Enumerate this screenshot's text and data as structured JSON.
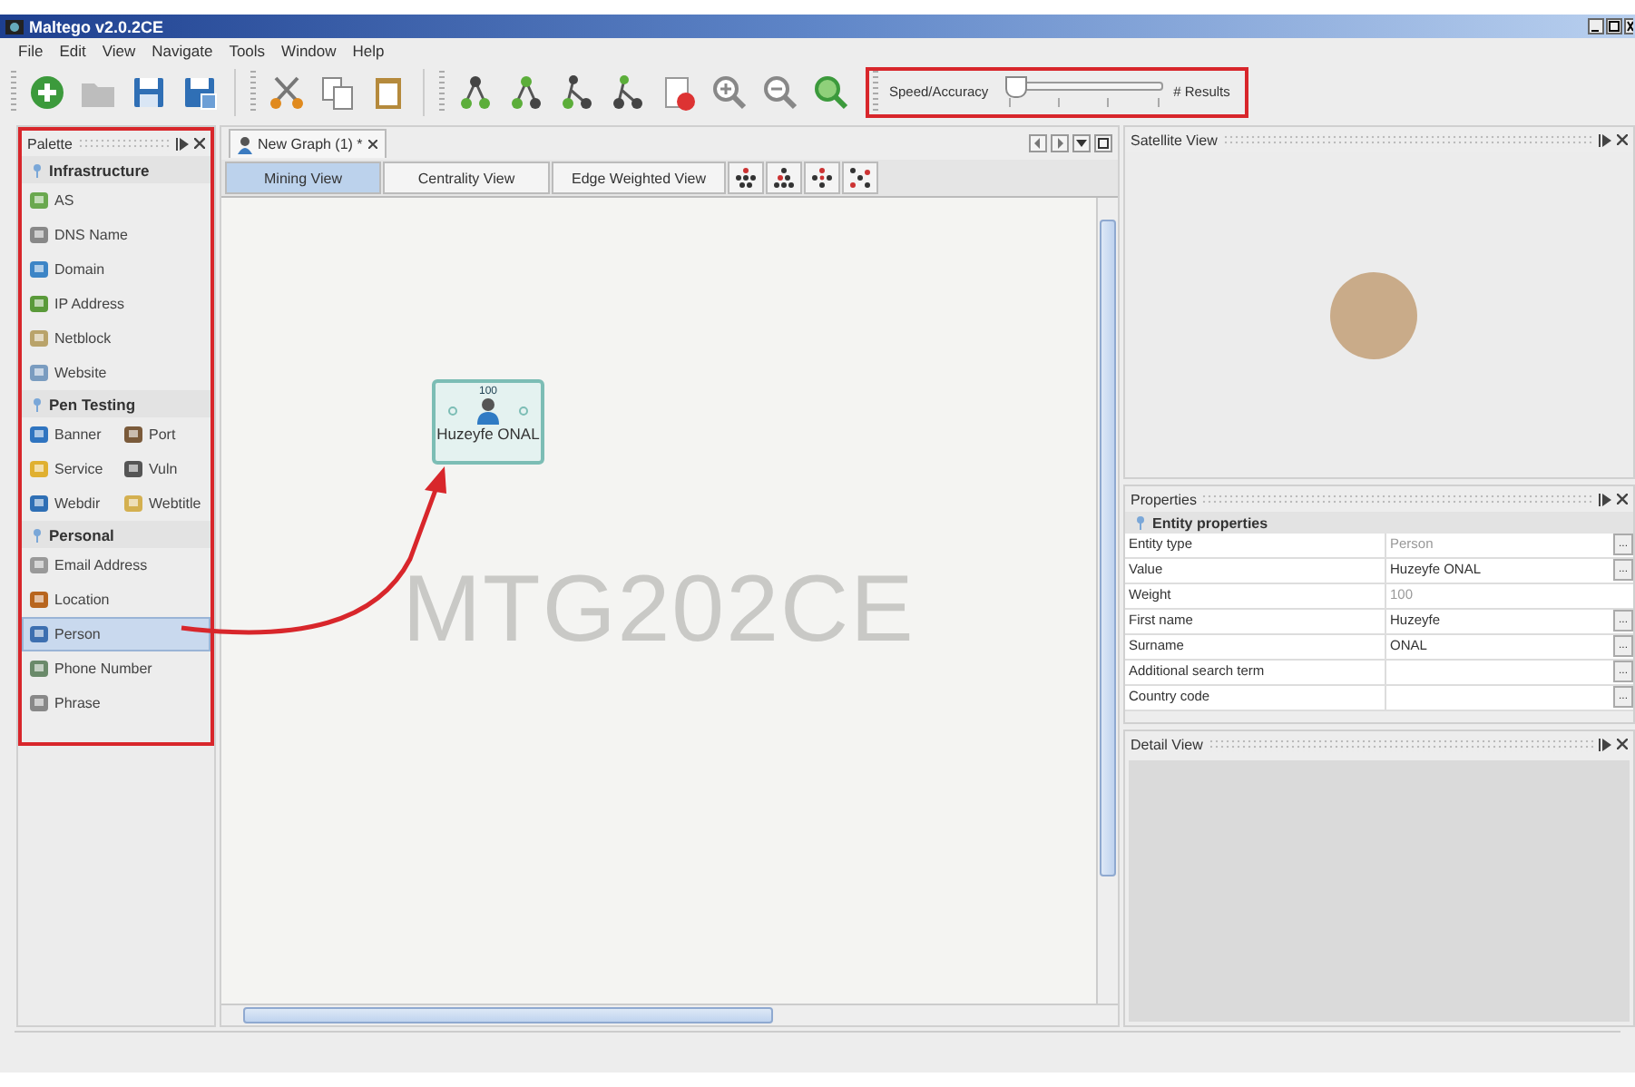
{
  "window": {
    "title": "Maltego v2.0.2CE"
  },
  "menu": [
    {
      "label": "File"
    },
    {
      "label": "Edit"
    },
    {
      "label": "View"
    },
    {
      "label": "Navigate"
    },
    {
      "label": "Tools"
    },
    {
      "label": "Window"
    },
    {
      "label": "Help"
    }
  ],
  "toolbar": {
    "slider": {
      "label": "Speed/Accuracy",
      "level": 0.04,
      "end_label": "# Results",
      "highlighted": true
    }
  },
  "palette": {
    "title": "Palette",
    "highlighted": true,
    "categories": [
      {
        "label": "Infrastructure",
        "kind": "list",
        "items": [
          {
            "label": "AS",
            "selected": false
          },
          {
            "label": "DNS Name",
            "selected": false
          },
          {
            "label": "Domain",
            "selected": false
          },
          {
            "label": "IP Address",
            "selected": false
          },
          {
            "label": "Netblock",
            "selected": false
          },
          {
            "label": "Website",
            "selected": false
          }
        ]
      },
      {
        "label": "Pen Testing",
        "kind": "grid",
        "items": [
          {
            "label": "Banner",
            "selected": false
          },
          {
            "label": "Port",
            "selected": false
          },
          {
            "label": "Service",
            "selected": false
          },
          {
            "label": "Vuln",
            "selected": false
          },
          {
            "label": "Webdir",
            "selected": false
          },
          {
            "label": "Webtitle",
            "selected": false
          }
        ]
      },
      {
        "label": "Personal",
        "kind": "list",
        "items": [
          {
            "label": "Email Address",
            "selected": false
          },
          {
            "label": "Location",
            "selected": false
          },
          {
            "label": "Person",
            "selected": true
          },
          {
            "label": "Phone Number",
            "selected": false
          },
          {
            "label": "Phrase",
            "selected": false
          }
        ]
      }
    ]
  },
  "graph": {
    "tab": {
      "label": "New Graph (1) *"
    },
    "view_tabs": [
      {
        "label": "Mining View",
        "selected": true
      },
      {
        "label": "Centrality View",
        "selected": false
      },
      {
        "label": "Edge Weighted View",
        "selected": false
      }
    ],
    "watermark": "MTG202CE",
    "nodes": [
      {
        "weight": "100",
        "label": "Huzeyfe ONAL"
      }
    ]
  },
  "satellite_view": {
    "title": "Satellite View"
  },
  "properties": {
    "title": "Properties",
    "section": "Entity properties",
    "rows": [
      {
        "name": "Entity type",
        "value": "Person",
        "editable": false,
        "button": "..."
      },
      {
        "name": "Value",
        "value": "Huzeyfe ONAL",
        "editable": true,
        "button": "..."
      },
      {
        "name": "Weight",
        "value": "100",
        "editable": false
      },
      {
        "name": "First name",
        "value": "Huzeyfe",
        "editable": true,
        "button": "..."
      },
      {
        "name": "Surname",
        "value": "ONAL",
        "editable": true,
        "button": "..."
      },
      {
        "name": "Additional search term",
        "button": "..."
      },
      {
        "name": "Country code",
        "button": "..."
      }
    ]
  },
  "detail_view": {
    "title": "Detail View"
  },
  "annotations": [
    {
      "kind": "arrow"
    }
  ]
}
